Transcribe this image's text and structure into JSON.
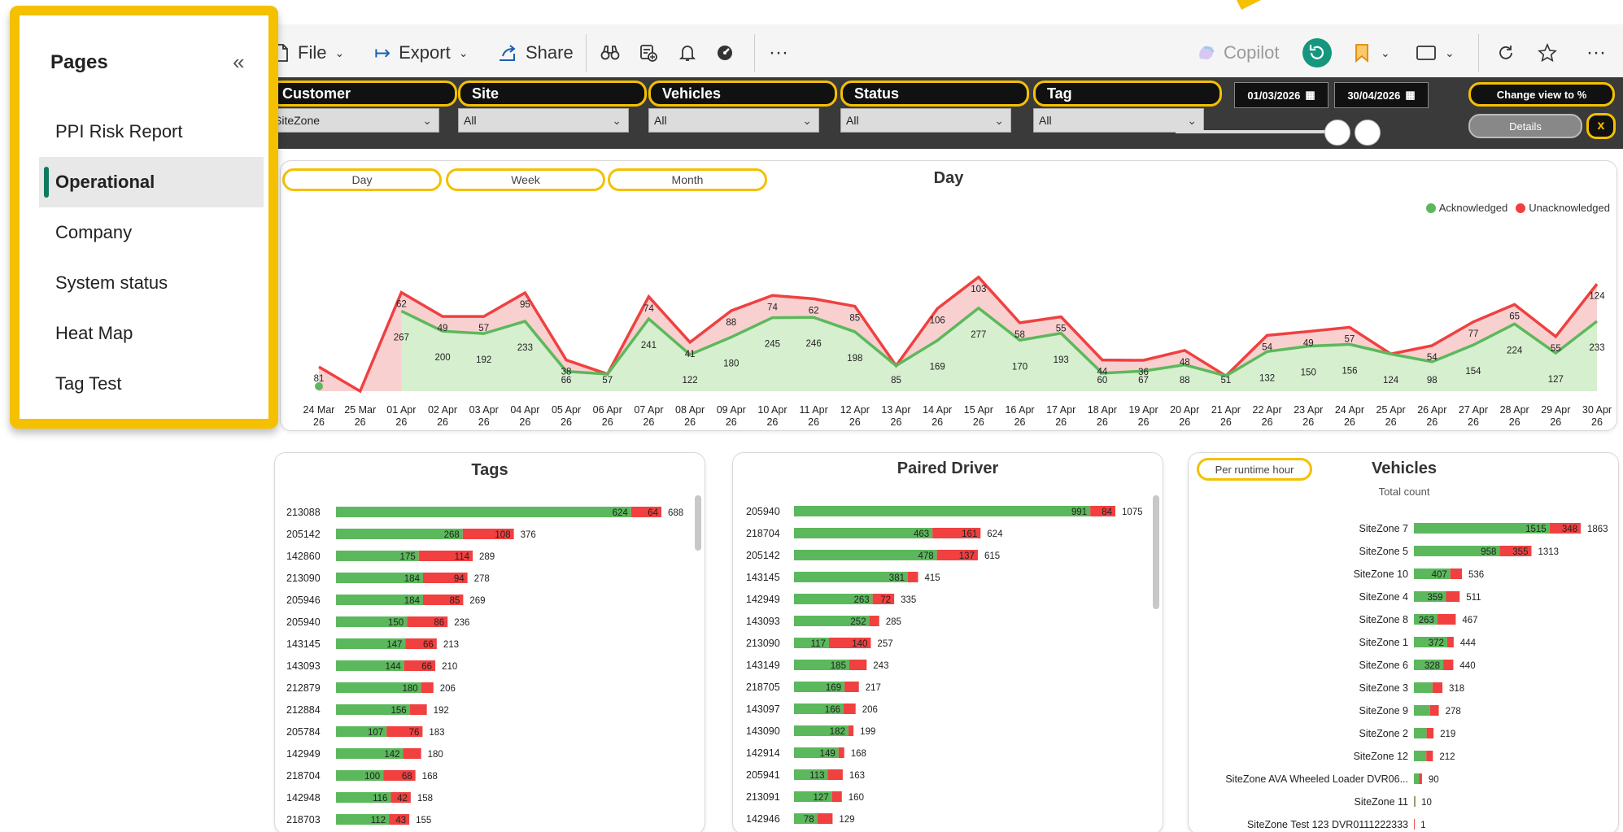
{
  "toolbar": {
    "file": "File",
    "export": "Export",
    "share": "Share",
    "more": "···",
    "copilot": "Copilot",
    "more_right": "···"
  },
  "pages": {
    "title": "Pages",
    "collapse_icon": "«",
    "items": [
      {
        "label": "PPI Risk Report",
        "active": false
      },
      {
        "label": "Operational",
        "active": true
      },
      {
        "label": "Company",
        "active": false
      },
      {
        "label": "System status",
        "active": false
      },
      {
        "label": "Heat Map",
        "active": false
      },
      {
        "label": "Tag Test",
        "active": false
      }
    ]
  },
  "filters": {
    "slicers": [
      {
        "label": "Customer",
        "value": "SiteZone"
      },
      {
        "label": "Site",
        "value": "All"
      },
      {
        "label": "Vehicles",
        "value": "All"
      },
      {
        "label": "Status",
        "value": "All"
      },
      {
        "label": "Tag",
        "value": "All"
      }
    ],
    "date_from": "01/03/2026",
    "date_to": "30/04/2026",
    "change_view": "Change view to %",
    "details": "Details",
    "close": "x"
  },
  "colors": {
    "acknowledged": "#5cb85c",
    "unacknowledged": "#f04040",
    "accent": "#f4c000"
  },
  "trend": {
    "title": "Day",
    "buttons": [
      "Day",
      "Week",
      "Month"
    ],
    "legend": [
      "Acknowledged",
      "Unacknowledged"
    ]
  },
  "chart_data": [
    {
      "type": "area",
      "title": "Day",
      "categories": [
        "24 Mar 26",
        "25 Mar 26",
        "01 Apr 26",
        "02 Apr 26",
        "03 Apr 26",
        "04 Apr 26",
        "05 Apr 26",
        "06 Apr 26",
        "07 Apr 26",
        "08 Apr 26",
        "09 Apr 26",
        "10 Apr 26",
        "11 Apr 26",
        "12 Apr 26",
        "13 Apr 26",
        "14 Apr 26",
        "15 Apr 26",
        "16 Apr 26",
        "17 Apr 26",
        "18 Apr 26",
        "19 Apr 26",
        "20 Apr 26",
        "21 Apr 26",
        "22 Apr 26",
        "23 Apr 26",
        "24 Apr 26",
        "25 Apr 26",
        "26 Apr 26",
        "27 Apr 26",
        "28 Apr 26",
        "29 Apr 26",
        "30 Apr 26"
      ],
      "series": [
        {
          "name": "Acknowledged",
          "values": [
            null,
            null,
            267,
            200,
            192,
            233,
            66,
            57,
            241,
            122,
            180,
            245,
            246,
            198,
            85,
            169,
            277,
            170,
            193,
            60,
            67,
            88,
            51,
            132,
            150,
            156,
            124,
            98,
            154,
            224,
            127,
            233
          ]
        },
        {
          "name": "Unacknowledged",
          "values": [
            81,
            null,
            62,
            49,
            57,
            95,
            38,
            null,
            74,
            41,
            88,
            74,
            62,
            85,
            null,
            106,
            103,
            58,
            55,
            44,
            36,
            48,
            null,
            54,
            49,
            57,
            null,
            54,
            77,
            65,
            55,
            124
          ]
        }
      ],
      "legend": "top-right"
    },
    {
      "type": "bar",
      "title": "Tags",
      "categories": [
        "213088",
        "205142",
        "142860",
        "213090",
        "205946",
        "205940",
        "143145",
        "143093",
        "212879",
        "212884",
        "205784",
        "142949",
        "218704",
        "142948",
        "218703"
      ],
      "series": [
        {
          "name": "Acknowledged",
          "values": [
            624,
            268,
            175,
            184,
            184,
            150,
            147,
            144,
            180,
            156,
            107,
            142,
            100,
            116,
            112
          ]
        },
        {
          "name": "Unacknowledged",
          "values": [
            64,
            108,
            114,
            94,
            85,
            86,
            66,
            66,
            null,
            null,
            76,
            null,
            68,
            42,
            43
          ]
        }
      ],
      "totals": [
        688,
        376,
        289,
        278,
        269,
        236,
        213,
        210,
        206,
        192,
        183,
        180,
        168,
        158,
        155
      ]
    },
    {
      "type": "bar",
      "title": "Paired Driver",
      "categories": [
        "205940",
        "218704",
        "205142",
        "143145",
        "142949",
        "143093",
        "213090",
        "143149",
        "218705",
        "143097",
        "143090",
        "142914",
        "205941",
        "213091",
        "142946"
      ],
      "series": [
        {
          "name": "Acknowledged",
          "values": [
            991,
            463,
            478,
            381,
            263,
            252,
            117,
            185,
            169,
            166,
            182,
            149,
            113,
            127,
            78
          ]
        },
        {
          "name": "Unacknowledged",
          "values": [
            84,
            161,
            137,
            null,
            72,
            null,
            140,
            null,
            null,
            null,
            null,
            null,
            null,
            null,
            null
          ]
        }
      ],
      "totals": [
        1075,
        624,
        615,
        415,
        335,
        285,
        257,
        243,
        217,
        206,
        199,
        168,
        163,
        160,
        129
      ]
    },
    {
      "type": "bar",
      "title": "Vehicles",
      "subtitle": "Total count",
      "categories": [
        "SiteZone 7",
        "SiteZone 5",
        "SiteZone 10",
        "SiteZone 4",
        "SiteZone 8",
        "SiteZone 1",
        "SiteZone 6",
        "SiteZone 3",
        "SiteZone 9",
        "SiteZone 2",
        "SiteZone 12",
        "SiteZone AVA Wheeled Loader DVR06...",
        "SiteZone 11",
        "SiteZone Test 123 DVR0111222333"
      ],
      "series": [
        {
          "name": "Acknowledged",
          "values": [
            1515,
            958,
            407,
            359,
            263,
            372,
            328,
            null,
            null,
            null,
            null,
            null,
            null,
            null
          ]
        },
        {
          "name": "Unacknowledged",
          "values": [
            348,
            355,
            null,
            null,
            null,
            null,
            null,
            null,
            null,
            null,
            null,
            null,
            null,
            null
          ]
        }
      ],
      "totals": [
        1863,
        1313,
        536,
        511,
        467,
        444,
        440,
        318,
        278,
        219,
        212,
        90,
        10,
        1
      ]
    }
  ],
  "tags": {
    "title": "Tags"
  },
  "paired": {
    "title": "Paired Driver"
  },
  "vehicles": {
    "title": "Vehicles",
    "subtitle": "Total count",
    "button": "Per runtime hour"
  }
}
